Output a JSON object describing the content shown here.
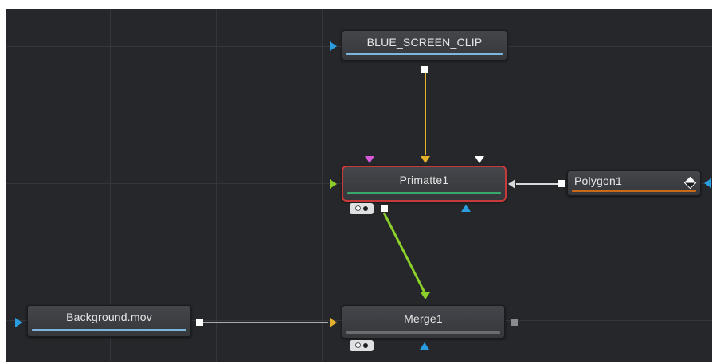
{
  "editor": {
    "nodes": {
      "blue_screen_clip": {
        "label": "BLUE_SCREEN_CLIP",
        "bar_color": "#7fb6e0"
      },
      "primatte1": {
        "label": "Primatte1",
        "bar_color": "#3aa86a",
        "selected": true
      },
      "polygon1": {
        "label": "Polygon1",
        "bar_color": "#c86a18"
      },
      "background_mov": {
        "label": "Background.mov",
        "bar_color": "#7fb6e0"
      },
      "merge1": {
        "label": "Merge1",
        "bar_color": "#6a6c70"
      }
    },
    "connections": [
      {
        "from": "BLUE_SCREEN_CLIP",
        "to": "Primatte1",
        "color": "#e5b12a"
      },
      {
        "from": "Polygon1",
        "to": "Primatte1",
        "color": "#d8d8d8"
      },
      {
        "from": "Primatte1",
        "to": "Merge1",
        "color": "#8ccf2a"
      },
      {
        "from": "Background.mov",
        "to": "Merge1",
        "color": "#d8d8d8"
      }
    ],
    "colors": {
      "background": "#26272b",
      "grid": "#34363b",
      "selected_outline": "#c63a3a",
      "input_blue": "#2a9de0",
      "background_input_yellow": "#e5b12a",
      "foreground_input_green": "#8ccf2a",
      "garbage_matte_input_magenta": "#d65ad8",
      "mask_output_gray": "#8a8b8e"
    }
  }
}
